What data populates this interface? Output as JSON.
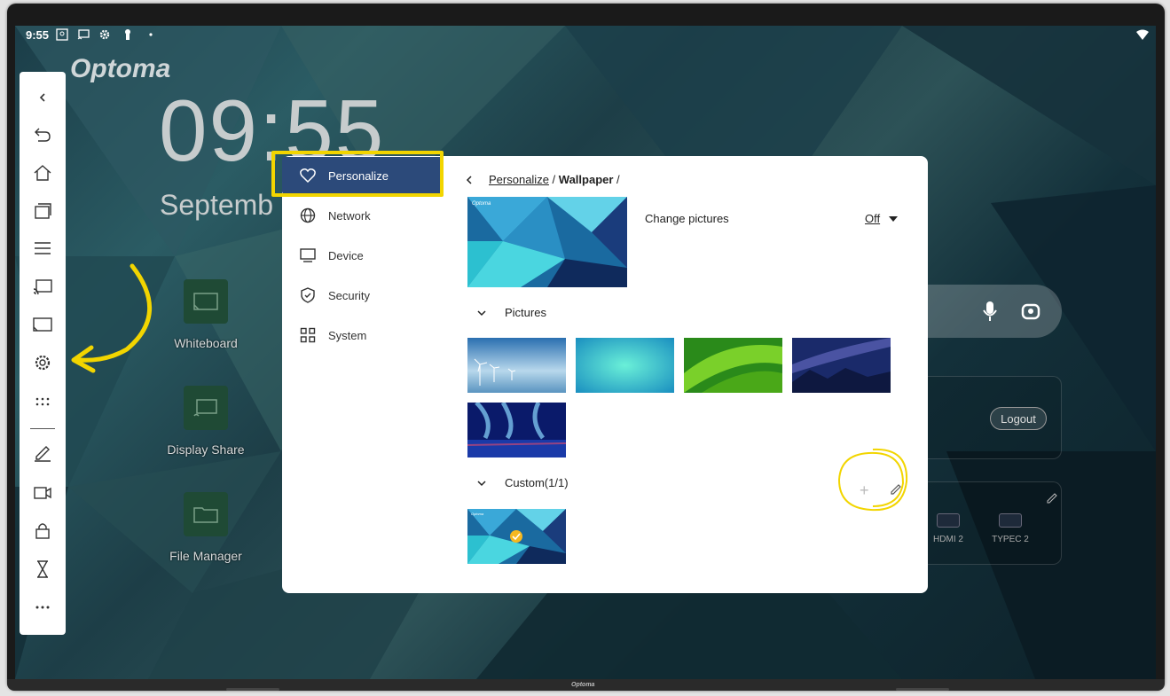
{
  "status_bar": {
    "time": "9:55"
  },
  "desktop": {
    "brand": "Optoma",
    "clock": "09:55",
    "date": "Septemb",
    "apps": [
      {
        "label": "Whiteboard"
      },
      {
        "label": "Display Share"
      },
      {
        "label": "File Manager"
      }
    ],
    "logout_label": "Logout",
    "sources": [
      "HDMI 2",
      "TYPEC 2"
    ]
  },
  "settings": {
    "nav": [
      {
        "label": "Personalize",
        "icon": "heart-icon",
        "active": true
      },
      {
        "label": "Network",
        "icon": "globe-icon"
      },
      {
        "label": "Device",
        "icon": "monitor-icon"
      },
      {
        "label": "Security",
        "icon": "shield-check-icon"
      },
      {
        "label": "System",
        "icon": "grid-icon"
      }
    ],
    "breadcrumb": {
      "link": "Personalize",
      "separator1": " / ",
      "current": "Wallpaper",
      "separator2": " /"
    },
    "change_pictures": {
      "label": "Change pictures",
      "value": "Off"
    },
    "pictures_header": "Pictures",
    "custom_header": "Custom(1/1)"
  },
  "bezel": {
    "brand": "Optoma"
  },
  "colors": {
    "active_nav": "#2c4a7a",
    "highlight": "#f2d500",
    "check": "#f5b820"
  }
}
